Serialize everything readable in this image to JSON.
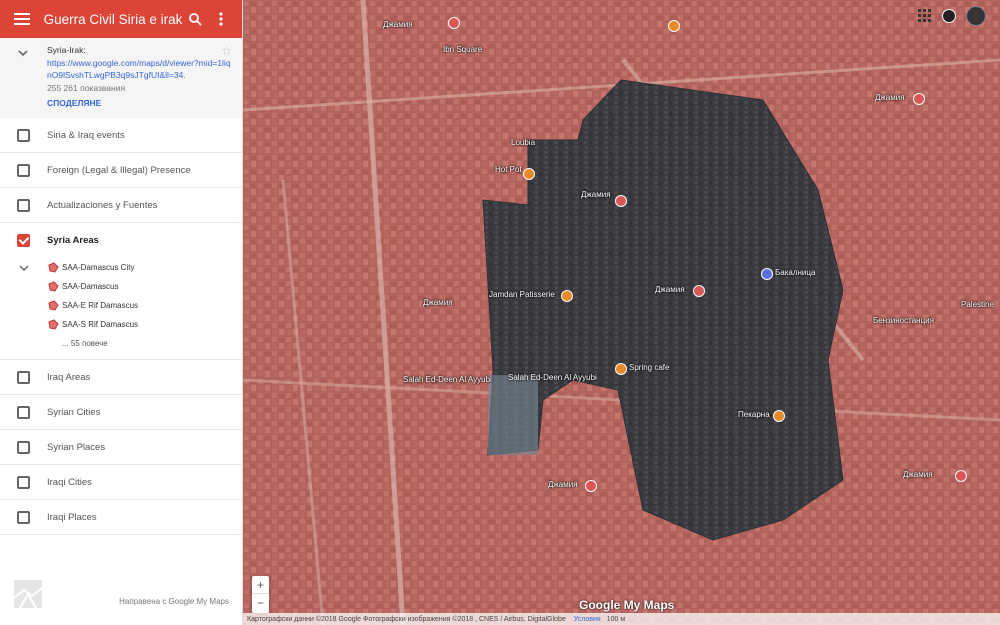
{
  "header": {
    "title": "Guerra Civil Siria e irak"
  },
  "map_info": {
    "name": "Syria-Irak:",
    "url": "https://www.google.com/maps/d/viewer?mid=1liqnO9lSvshTLwgPB3q9sJTgfUI&ll=34.",
    "views": "255 261 показвания",
    "share": "СПОДЕЛЯНЕ"
  },
  "layers_top": [
    {
      "label": "Siria & Iraq events",
      "checked": false
    },
    {
      "label": "Foreign (Legal & Illegal) Presence",
      "checked": false
    },
    {
      "label": "Actualizaciones y Fuentes",
      "checked": false
    }
  ],
  "active_layer": {
    "label": "Syria Areas",
    "checked": true,
    "items": [
      "SAA-Damascus City",
      "SAA-Damascus",
      "SAA-E Rif Damascus",
      "SAA-S Rif Damascus"
    ],
    "more": "... 55 повече"
  },
  "layers_bottom": [
    {
      "label": "Iraq Areas",
      "checked": false
    },
    {
      "label": "Syrian Cities",
      "checked": false
    },
    {
      "label": "Syrian Places",
      "checked": false
    },
    {
      "label": "Iraqi Cities",
      "checked": false
    },
    {
      "label": "Iraqi Places",
      "checked": false
    }
  ],
  "footer": {
    "made_with": "Направена с Google My Maps"
  },
  "map": {
    "labels": [
      "Джамия",
      "Джамия",
      "Джамия",
      "Джамия",
      "Джамия",
      "Джамия",
      "Джамия",
      "Hot Pot",
      "Jamdan Patisserie",
      "Spring cafe",
      "Salah Ed-Deen Al Ayyubi",
      "Пекарна",
      "Бакалница",
      "Бензиностанция",
      "Palestine",
      "Loubia",
      "Ibn Square",
      "Salah Ed-Deen Al Ayyubi"
    ],
    "zoom_in": "+",
    "zoom_out": "−",
    "brand": "Google My Maps",
    "attribution": "Картографски данни ©2018 Google Фотографски изображения ©2018 , CNES / Airbus, DigitalGlobe",
    "terms": "Условия",
    "scale": "100 м"
  },
  "colors": {
    "accent": "#db4437",
    "overlay_red": "#c85a5a",
    "overlay_dark": "#3a3d42",
    "link": "#3367d6"
  }
}
